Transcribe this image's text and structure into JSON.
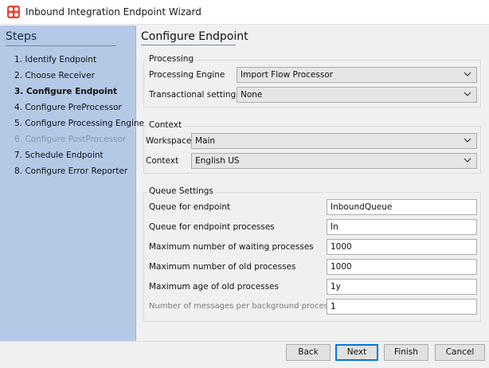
{
  "window": {
    "title": "Inbound Integration Endpoint Wizard",
    "icon": "app-logo-icon"
  },
  "steps": {
    "heading": "Steps",
    "items": [
      {
        "label": "1. Identify Endpoint",
        "state": "normal"
      },
      {
        "label": "2. Choose Receiver",
        "state": "normal"
      },
      {
        "label": "3. Configure Endpoint",
        "state": "active"
      },
      {
        "label": "4. Configure PreProcessor",
        "state": "normal"
      },
      {
        "label": "5. Configure Processing Engine",
        "state": "normal"
      },
      {
        "label": "6. Configure PostProcessor",
        "state": "disabled"
      },
      {
        "label": "7. Schedule Endpoint",
        "state": "normal"
      },
      {
        "label": "8. Configure Error Reporter",
        "state": "normal"
      }
    ]
  },
  "main": {
    "title": "Configure Endpoint",
    "processing": {
      "legend": "Processing",
      "engine_label": "Processing Engine",
      "engine_value": "Import Flow Processor",
      "transactional_label": "Transactional settings",
      "transactional_value": "None"
    },
    "context": {
      "legend": "Context",
      "workspace_label": "Workspace",
      "workspace_value": "Main",
      "context_label": "Context",
      "context_value": "English US"
    },
    "queue": {
      "legend": "Queue Settings",
      "rows": [
        {
          "label": "Queue for endpoint",
          "value": "InboundQueue",
          "enabled": true
        },
        {
          "label": "Queue for endpoint processes",
          "value": "In",
          "enabled": true
        },
        {
          "label": "Maximum number of waiting processes",
          "value": "1000",
          "enabled": true
        },
        {
          "label": "Maximum number of old processes",
          "value": "1000",
          "enabled": true
        },
        {
          "label": "Maximum age of old processes",
          "value": "1y",
          "enabled": true
        },
        {
          "label": "Number of messages per background process",
          "value": "1",
          "enabled": false
        }
      ]
    }
  },
  "buttons": {
    "back": "Back",
    "next": "Next",
    "finish": "Finish",
    "cancel": "Cancel"
  },
  "colors": {
    "steps_panel": "#b4c9e6",
    "accent": "#0078d7",
    "logo": "#e8483b"
  }
}
